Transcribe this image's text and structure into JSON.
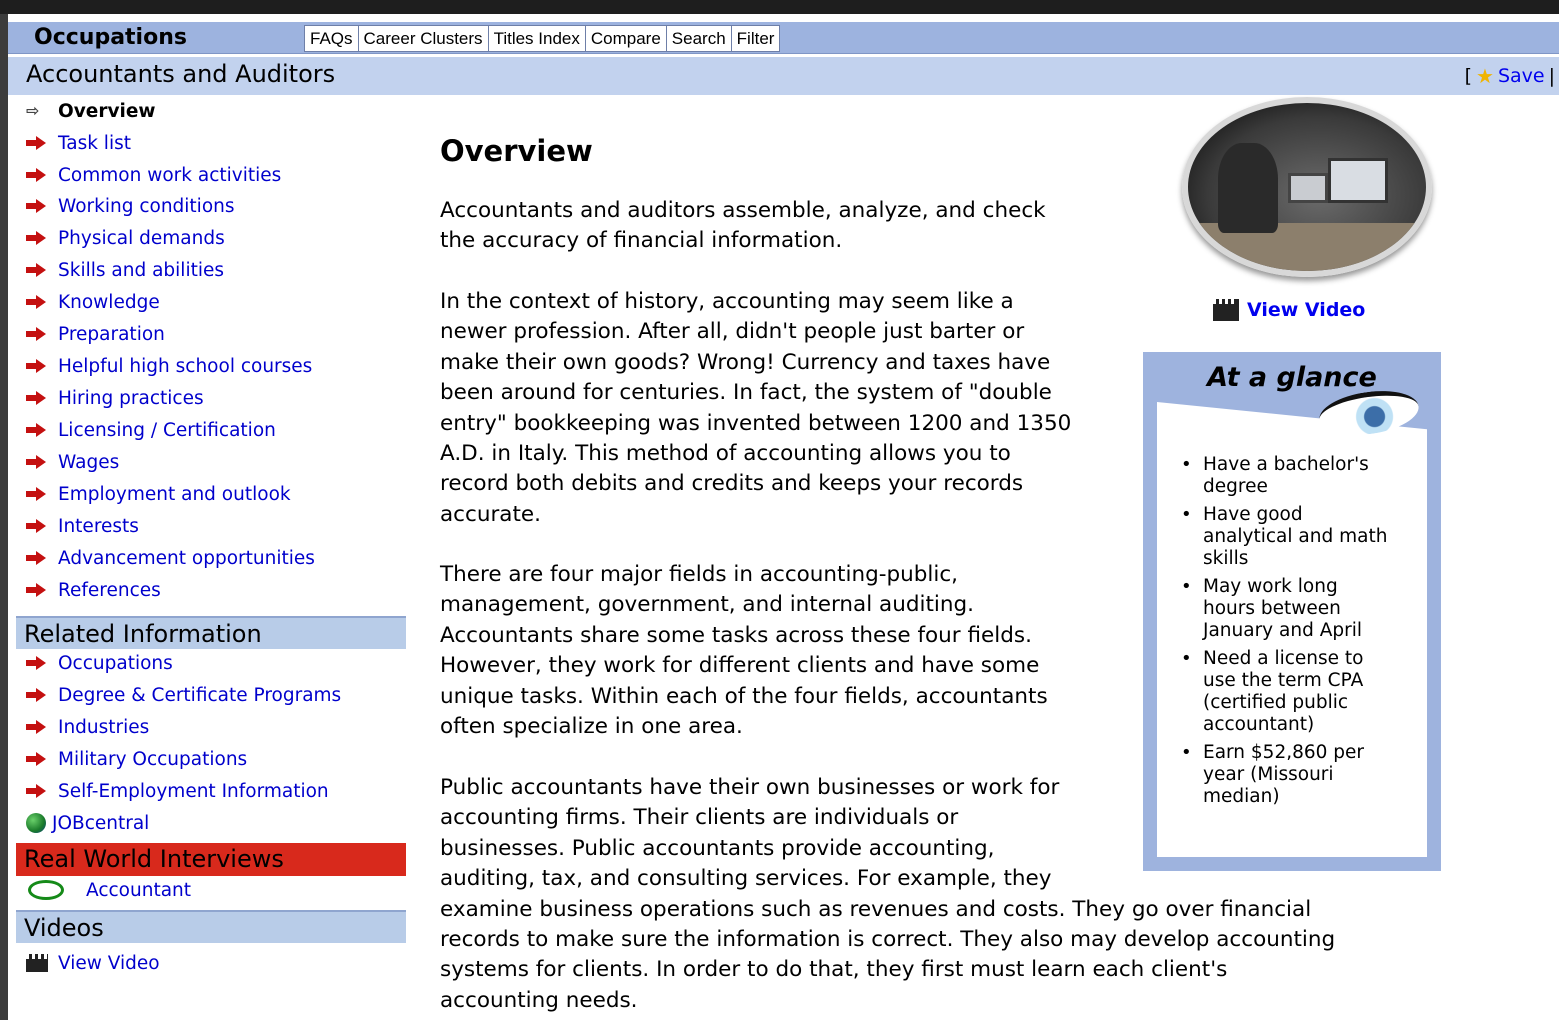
{
  "nav": {
    "title": "Occupations",
    "tabs": [
      "FAQs",
      "Career Clusters",
      "Titles Index",
      "Compare",
      "Search",
      "Filter"
    ]
  },
  "header": {
    "title": "Accountants and Auditors",
    "save_prefix": "[",
    "save_label": "Save",
    "save_suffix": "|"
  },
  "sidebar": {
    "items": [
      {
        "label": "Overview",
        "current": true
      },
      {
        "label": "Task list"
      },
      {
        "label": "Common work activities"
      },
      {
        "label": "Working conditions"
      },
      {
        "label": "Physical demands"
      },
      {
        "label": "Skills and abilities"
      },
      {
        "label": "Knowledge"
      },
      {
        "label": "Preparation"
      },
      {
        "label": "Helpful high school courses"
      },
      {
        "label": "Hiring practices"
      },
      {
        "label": "Licensing / Certification"
      },
      {
        "label": "Wages"
      },
      {
        "label": "Employment and outlook"
      },
      {
        "label": "Interests"
      },
      {
        "label": "Advancement opportunities"
      },
      {
        "label": "References"
      }
    ],
    "related_heading": "Related Information",
    "related_items": [
      "Occupations",
      "Degree & Certificate Programs",
      "Industries",
      "Military Occupations",
      "Self-Employment Information"
    ],
    "jobcentral_label": "JOBcentral",
    "rwi_heading": "Real World Interviews",
    "rwi_item": "Accountant",
    "videos_heading": "Videos",
    "videos_item": "View Video"
  },
  "main": {
    "heading": "Overview",
    "paragraphs": [
      [
        "Accountants and auditors assemble, analyze, and check",
        "the accuracy of financial information."
      ],
      [
        "In the context of history, accounting may seem like a",
        "newer profession. After all, didn't people just barter or",
        "make their own goods? Wrong! Currency and taxes have",
        "been around for centuries. In fact, the system of \"double",
        "entry\" bookkeeping was invented between 1200 and 1350",
        "A.D. in Italy. This method of accounting allows you to",
        "record both debits and credits and keeps your records",
        "accurate."
      ],
      [
        "There are four major fields in accounting-public,",
        "management, government, and internal auditing.",
        "Accountants share some tasks across these four fields.",
        "However, they work for different clients and have some",
        "unique tasks. Within each of the four fields, accountants",
        "often specialize in one area."
      ],
      [
        "Public accountants have their own businesses or work for",
        "accounting firms. Their clients are individuals or",
        "businesses. Public accountants provide accounting,",
        "auditing, tax, and consulting services. For example, they",
        "examine business operations such as revenues and costs. They go over financial",
        "records to make sure the information is correct. They also may develop accounting",
        "systems for clients. In order to do that, they first must learn each client's",
        "accounting needs."
      ]
    ],
    "view_video_label": "View Video"
  },
  "glance": {
    "title": "At a glance",
    "items": [
      [
        "Have a bachelor's",
        "degree"
      ],
      [
        "Have good",
        "analytical and math",
        "skills"
      ],
      [
        "May work long",
        "hours between",
        "January and April"
      ],
      [
        "Need a license to",
        "use the term CPA",
        "(certified public",
        "accountant)"
      ],
      [
        "Earn $52,860 per",
        "year (Missouri",
        "median)"
      ]
    ]
  },
  "colors": {
    "nav_bg": "#9db3df",
    "title_bg": "#c2d2ee",
    "link": "#0000cc",
    "arrow": "#c41010",
    "rwi_bg": "#d8291c",
    "glance_bg": "#9eb3de"
  },
  "icons": {
    "menu_arrow": "red-arrow-icon",
    "current_arrow": "outline-arrow-icon",
    "save": "star-icon",
    "video": "clapperboard-icon",
    "jobcentral": "globe-icon",
    "interview": "speech-bubble-icon",
    "glance": "eye-icon"
  }
}
